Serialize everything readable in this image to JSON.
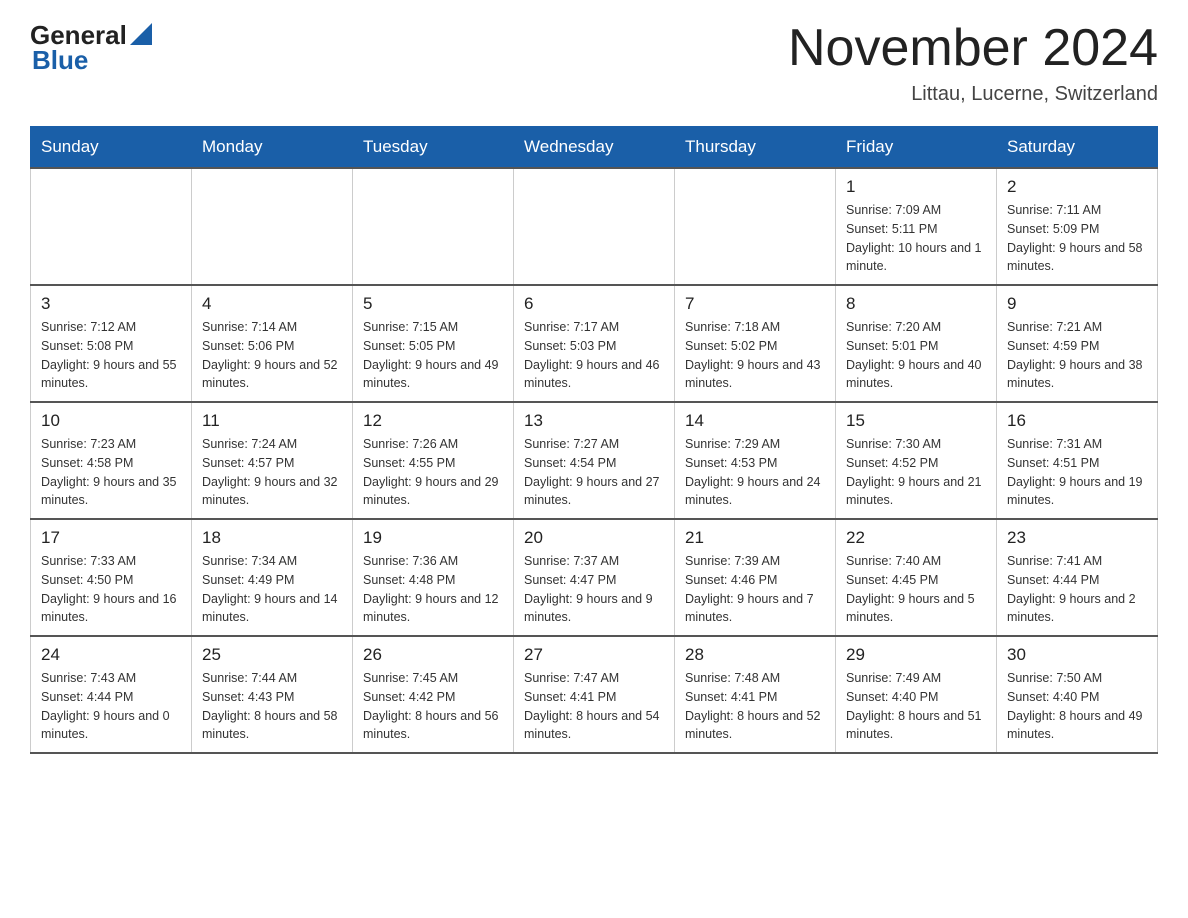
{
  "logo": {
    "general": "General",
    "blue": "Blue"
  },
  "header": {
    "title": "November 2024",
    "subtitle": "Littau, Lucerne, Switzerland"
  },
  "weekdays": [
    "Sunday",
    "Monday",
    "Tuesday",
    "Wednesday",
    "Thursday",
    "Friday",
    "Saturday"
  ],
  "weeks": [
    [
      {
        "day": "",
        "info": ""
      },
      {
        "day": "",
        "info": ""
      },
      {
        "day": "",
        "info": ""
      },
      {
        "day": "",
        "info": ""
      },
      {
        "day": "",
        "info": ""
      },
      {
        "day": "1",
        "info": "Sunrise: 7:09 AM\nSunset: 5:11 PM\nDaylight: 10 hours and 1 minute."
      },
      {
        "day": "2",
        "info": "Sunrise: 7:11 AM\nSunset: 5:09 PM\nDaylight: 9 hours and 58 minutes."
      }
    ],
    [
      {
        "day": "3",
        "info": "Sunrise: 7:12 AM\nSunset: 5:08 PM\nDaylight: 9 hours and 55 minutes."
      },
      {
        "day": "4",
        "info": "Sunrise: 7:14 AM\nSunset: 5:06 PM\nDaylight: 9 hours and 52 minutes."
      },
      {
        "day": "5",
        "info": "Sunrise: 7:15 AM\nSunset: 5:05 PM\nDaylight: 9 hours and 49 minutes."
      },
      {
        "day": "6",
        "info": "Sunrise: 7:17 AM\nSunset: 5:03 PM\nDaylight: 9 hours and 46 minutes."
      },
      {
        "day": "7",
        "info": "Sunrise: 7:18 AM\nSunset: 5:02 PM\nDaylight: 9 hours and 43 minutes."
      },
      {
        "day": "8",
        "info": "Sunrise: 7:20 AM\nSunset: 5:01 PM\nDaylight: 9 hours and 40 minutes."
      },
      {
        "day": "9",
        "info": "Sunrise: 7:21 AM\nSunset: 4:59 PM\nDaylight: 9 hours and 38 minutes."
      }
    ],
    [
      {
        "day": "10",
        "info": "Sunrise: 7:23 AM\nSunset: 4:58 PM\nDaylight: 9 hours and 35 minutes."
      },
      {
        "day": "11",
        "info": "Sunrise: 7:24 AM\nSunset: 4:57 PM\nDaylight: 9 hours and 32 minutes."
      },
      {
        "day": "12",
        "info": "Sunrise: 7:26 AM\nSunset: 4:55 PM\nDaylight: 9 hours and 29 minutes."
      },
      {
        "day": "13",
        "info": "Sunrise: 7:27 AM\nSunset: 4:54 PM\nDaylight: 9 hours and 27 minutes."
      },
      {
        "day": "14",
        "info": "Sunrise: 7:29 AM\nSunset: 4:53 PM\nDaylight: 9 hours and 24 minutes."
      },
      {
        "day": "15",
        "info": "Sunrise: 7:30 AM\nSunset: 4:52 PM\nDaylight: 9 hours and 21 minutes."
      },
      {
        "day": "16",
        "info": "Sunrise: 7:31 AM\nSunset: 4:51 PM\nDaylight: 9 hours and 19 minutes."
      }
    ],
    [
      {
        "day": "17",
        "info": "Sunrise: 7:33 AM\nSunset: 4:50 PM\nDaylight: 9 hours and 16 minutes."
      },
      {
        "day": "18",
        "info": "Sunrise: 7:34 AM\nSunset: 4:49 PM\nDaylight: 9 hours and 14 minutes."
      },
      {
        "day": "19",
        "info": "Sunrise: 7:36 AM\nSunset: 4:48 PM\nDaylight: 9 hours and 12 minutes."
      },
      {
        "day": "20",
        "info": "Sunrise: 7:37 AM\nSunset: 4:47 PM\nDaylight: 9 hours and 9 minutes."
      },
      {
        "day": "21",
        "info": "Sunrise: 7:39 AM\nSunset: 4:46 PM\nDaylight: 9 hours and 7 minutes."
      },
      {
        "day": "22",
        "info": "Sunrise: 7:40 AM\nSunset: 4:45 PM\nDaylight: 9 hours and 5 minutes."
      },
      {
        "day": "23",
        "info": "Sunrise: 7:41 AM\nSunset: 4:44 PM\nDaylight: 9 hours and 2 minutes."
      }
    ],
    [
      {
        "day": "24",
        "info": "Sunrise: 7:43 AM\nSunset: 4:44 PM\nDaylight: 9 hours and 0 minutes."
      },
      {
        "day": "25",
        "info": "Sunrise: 7:44 AM\nSunset: 4:43 PM\nDaylight: 8 hours and 58 minutes."
      },
      {
        "day": "26",
        "info": "Sunrise: 7:45 AM\nSunset: 4:42 PM\nDaylight: 8 hours and 56 minutes."
      },
      {
        "day": "27",
        "info": "Sunrise: 7:47 AM\nSunset: 4:41 PM\nDaylight: 8 hours and 54 minutes."
      },
      {
        "day": "28",
        "info": "Sunrise: 7:48 AM\nSunset: 4:41 PM\nDaylight: 8 hours and 52 minutes."
      },
      {
        "day": "29",
        "info": "Sunrise: 7:49 AM\nSunset: 4:40 PM\nDaylight: 8 hours and 51 minutes."
      },
      {
        "day": "30",
        "info": "Sunrise: 7:50 AM\nSunset: 4:40 PM\nDaylight: 8 hours and 49 minutes."
      }
    ]
  ]
}
